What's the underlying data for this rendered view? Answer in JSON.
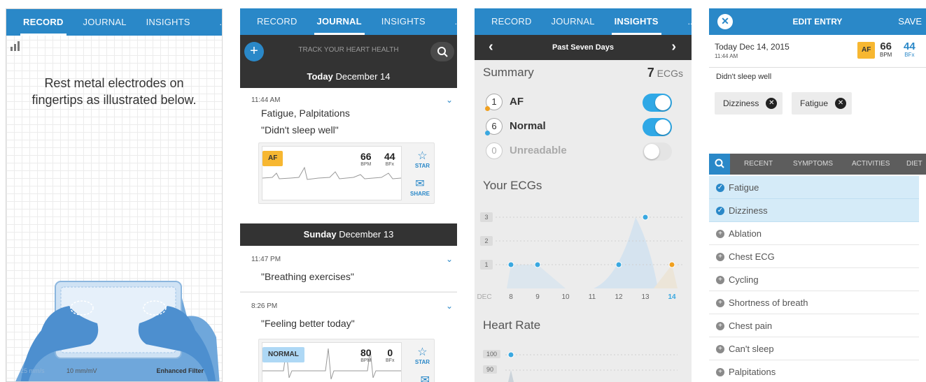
{
  "tabs": {
    "record": "RECORD",
    "journal": "JOURNAL",
    "insights": "INSIGHTS",
    "more": "..."
  },
  "record": {
    "instruction": "Rest metal electrodes on fingertips as illustrated below.",
    "speed": "25 mm/s",
    "gain": "10 mm/mV",
    "filter": "Enhanced Filter"
  },
  "journal": {
    "banner": "TRACK YOUR HEART HEALTH",
    "days": [
      {
        "bold": "Today",
        "rest": "December 14"
      },
      {
        "bold": "Sunday",
        "rest": "December 13"
      }
    ],
    "entries": [
      {
        "time": "11:44 AM",
        "symptoms": "Fatigue, Palpitations",
        "note": "\"Didn't sleep well\"",
        "tag": "AF",
        "bpm": "66",
        "bpm_unit": "BPM",
        "bfx": "44",
        "bfx_unit": "BFx",
        "star": "STAR",
        "share": "SHARE"
      },
      {
        "time": "11:47 PM",
        "note": "\"Breathing exercises\""
      },
      {
        "time": "8:26 PM",
        "note": "\"Feeling better today\"",
        "tag": "NORMAL",
        "bpm": "80",
        "bpm_unit": "BPM",
        "bfx": "0",
        "bfx_unit": "BFx",
        "star": "STAR"
      }
    ]
  },
  "insights": {
    "period": "Past Seven Days",
    "summary_title": "Summary",
    "ecg_count": "7",
    "ecg_unit": "ECGs",
    "rows": [
      {
        "count": "1",
        "label": "AF",
        "on": true,
        "color": "#f0a020"
      },
      {
        "count": "6",
        "label": "Normal",
        "on": true,
        "color": "#3aa8e0"
      },
      {
        "count": "0",
        "label": "Unreadable",
        "on": false,
        "color": ""
      }
    ],
    "your_ecgs": "Your ECGs",
    "heart_rate": "Heart Rate",
    "hr_ticks": [
      "100",
      "90"
    ],
    "colors": {
      "normal": "#3aa8e0",
      "af": "#f0a020",
      "toggle_on": "#2fa8e6"
    }
  },
  "chart_data": {
    "type": "scatter",
    "title": "Your ECGs",
    "xlabel": "",
    "ylabel": "",
    "categories": [
      "DEC",
      "8",
      "9",
      "10",
      "11",
      "12",
      "13",
      "14"
    ],
    "y_ticks": [
      "3",
      "2",
      "1"
    ],
    "ylim": [
      0,
      3
    ],
    "series": [
      {
        "name": "Normal",
        "points": [
          {
            "x": "8",
            "y": 1
          },
          {
            "x": "9",
            "y": 1
          },
          {
            "x": "12",
            "y": 1
          },
          {
            "x": "13",
            "y": 3
          }
        ]
      },
      {
        "name": "AF",
        "points": [
          {
            "x": "14",
            "y": 1
          }
        ]
      }
    ]
  },
  "edit": {
    "title": "EDIT ENTRY",
    "save": "SAVE",
    "date": "Today Dec 14, 2015",
    "time": "11:44 AM",
    "tag": "AF",
    "bpm": "66",
    "bpm_unit": "BPM",
    "bfx": "44",
    "bfx_unit": "BFx",
    "note": "Didn't sleep well",
    "chips": [
      "Dizziness",
      "Fatigue"
    ],
    "tabs": [
      "RECENT",
      "SYMPTOMS",
      "ACTIVITIES",
      "DIET"
    ],
    "items": [
      {
        "label": "Fatigue",
        "selected": true
      },
      {
        "label": "Dizziness",
        "selected": true
      },
      {
        "label": "Ablation",
        "selected": false
      },
      {
        "label": "Chest ECG",
        "selected": false
      },
      {
        "label": "Cycling",
        "selected": false
      },
      {
        "label": "Shortness of breath",
        "selected": false
      },
      {
        "label": "Chest pain",
        "selected": false
      },
      {
        "label": "Can't sleep",
        "selected": false
      },
      {
        "label": "Palpitations",
        "selected": false
      }
    ]
  }
}
